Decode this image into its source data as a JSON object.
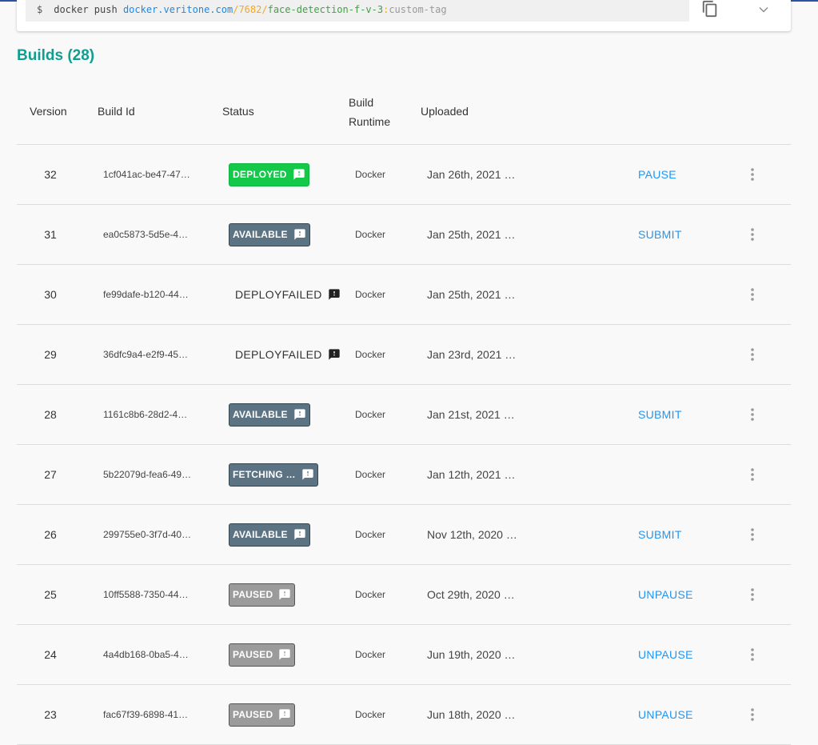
{
  "command": {
    "prompt": "$",
    "base": "docker push ",
    "host": "docker.veritone.com",
    "sep1": "/",
    "org": "7682",
    "sep2": "/",
    "repo": "face-detection-f-v-3",
    "sep3": ":",
    "tag": "custom-tag"
  },
  "icons": {
    "copy": "copy-icon",
    "expand": "chevron-down-icon",
    "feedback": "feedback-icon",
    "menu": "more-vert-icon"
  },
  "colors": {
    "accent": "#119e8f",
    "link": "#2196f3",
    "deployed": "#14c84a",
    "available": "#5b7382",
    "paused": "#9b9b9b"
  },
  "builds": {
    "title": "Builds (28)",
    "columns": {
      "version": "Version",
      "build_id": "Build Id",
      "status": "Status",
      "runtime_line1": "Build",
      "runtime_line2": "Runtime",
      "uploaded": "Uploaded"
    },
    "rows": [
      {
        "version": "32",
        "build_id": "1cf041ac-be47-47…",
        "status": "DEPLOYED",
        "status_style": "deployed",
        "runtime": "Docker",
        "uploaded": "Jan 26th, 2021 …",
        "action": "PAUSE"
      },
      {
        "version": "31",
        "build_id": "ea0c5873-5d5e-4…",
        "status": "AVAILABLE",
        "status_style": "available",
        "runtime": "Docker",
        "uploaded": "Jan 25th, 2021 …",
        "action": "SUBMIT"
      },
      {
        "version": "30",
        "build_id": "fe99dafe-b120-44…",
        "status": "DEPLOYFAILED",
        "status_style": "plain",
        "runtime": "Docker",
        "uploaded": "Jan 25th, 2021 …",
        "action": ""
      },
      {
        "version": "29",
        "build_id": "36dfc9a4-e2f9-45…",
        "status": "DEPLOYFAILED",
        "status_style": "plain",
        "runtime": "Docker",
        "uploaded": "Jan 23rd, 2021 …",
        "action": ""
      },
      {
        "version": "28",
        "build_id": "1161c8b6-28d2-4…",
        "status": "AVAILABLE",
        "status_style": "available",
        "runtime": "Docker",
        "uploaded": "Jan 21st, 2021 …",
        "action": "SUBMIT"
      },
      {
        "version": "27",
        "build_id": "5b22079d-fea6-49…",
        "status": "FETCHING …",
        "status_style": "fetching",
        "runtime": "Docker",
        "uploaded": "Jan 12th, 2021 …",
        "action": ""
      },
      {
        "version": "26",
        "build_id": "299755e0-3f7d-40…",
        "status": "AVAILABLE",
        "status_style": "available",
        "runtime": "Docker",
        "uploaded": "Nov 12th, 2020 …",
        "action": "SUBMIT"
      },
      {
        "version": "25",
        "build_id": "10ff5588-7350-44…",
        "status": "PAUSED",
        "status_style": "paused",
        "runtime": "Docker",
        "uploaded": "Oct 29th, 2020 …",
        "action": "UNPAUSE"
      },
      {
        "version": "24",
        "build_id": "4a4db168-0ba5-4…",
        "status": "PAUSED",
        "status_style": "paused",
        "runtime": "Docker",
        "uploaded": "Jun 19th, 2020 …",
        "action": "UNPAUSE"
      },
      {
        "version": "23",
        "build_id": "fac67f39-6898-41…",
        "status": "PAUSED",
        "status_style": "paused",
        "runtime": "Docker",
        "uploaded": "Jun 18th, 2020 …",
        "action": "UNPAUSE"
      }
    ]
  }
}
